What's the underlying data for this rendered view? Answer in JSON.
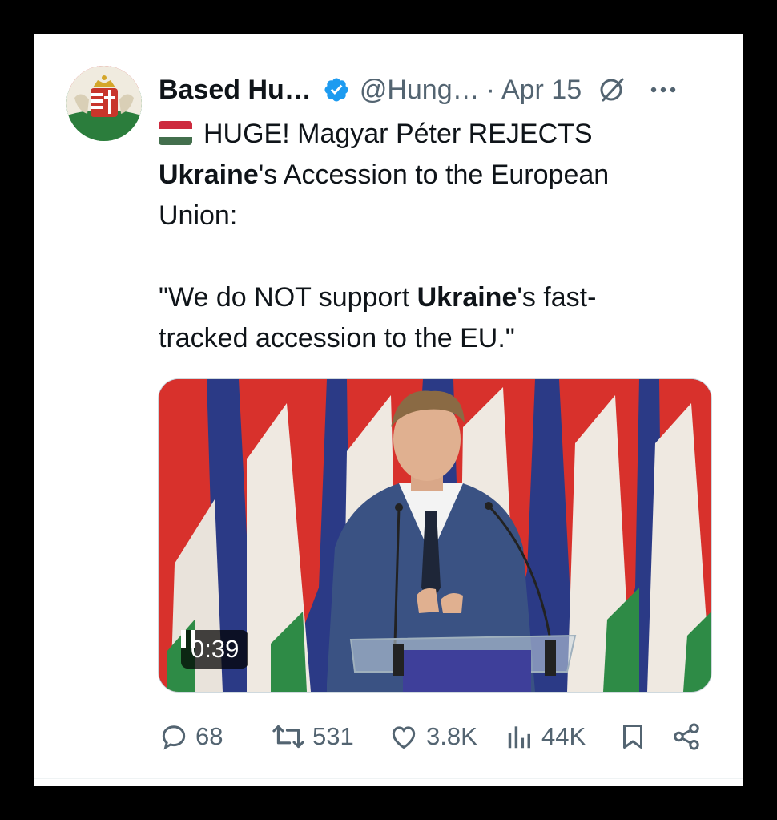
{
  "tweet": {
    "author_name": "Based Hu…",
    "handle": "@Hung…",
    "separator": "·",
    "date": "Apr 15",
    "text": {
      "line1_prefix": "HUGE! Magyar Péter REJECTS",
      "line2_bold": "Ukraine",
      "line2_rest": "'s Accession to the European",
      "line3": "Union:",
      "quote_open": "\"We do NOT support ",
      "quote_bold": "Ukraine",
      "quote_rest": "'s fast-",
      "quote_line2": "tracked accession to the EU.\""
    },
    "media": {
      "type": "video",
      "duration": "0:39"
    },
    "stats": {
      "replies": "68",
      "reposts": "531",
      "likes": "3.8K",
      "views": "44K"
    },
    "icons": [
      "verified-badge-icon",
      "grok-icon",
      "more-icon",
      "reply-icon",
      "repost-icon",
      "like-icon",
      "views-icon",
      "bookmark-icon",
      "share-icon",
      "pause-icon",
      "hungary-flag-emoji"
    ],
    "colors": {
      "text": "#0f1419",
      "secondary": "#536471",
      "verified": "#1d9bf0",
      "flag_red": "#cd2a3e",
      "flag_white": "#ffffff",
      "flag_green": "#436f4d"
    }
  }
}
